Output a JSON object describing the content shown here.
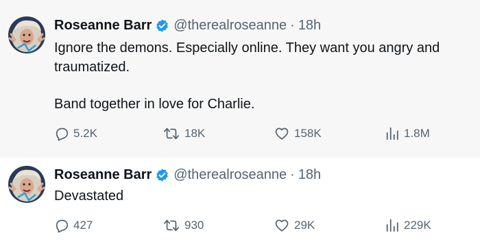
{
  "tweets": [
    {
      "author": {
        "name": "Roseanne Barr",
        "handle": "@therealroseanne",
        "verified": true,
        "avatar_icon": "avatar-photo"
      },
      "separator": "·",
      "time": "18h",
      "text_lines": [
        "Ignore the demons. Especially online. They want you angry and",
        "traumatized.",
        "Band together in love for Charlie."
      ],
      "stats": {
        "replies": "5.2K",
        "retweets": "18K",
        "likes": "158K",
        "views": "1.8M"
      }
    },
    {
      "author": {
        "name": "Roseanne Barr",
        "handle": "@therealroseanne",
        "verified": true,
        "avatar_icon": "avatar-photo"
      },
      "separator": "·",
      "time": "18h",
      "text_lines": [
        "Devastated"
      ],
      "stats": {
        "replies": "427",
        "retweets": "930",
        "likes": "29K",
        "views": "229K"
      }
    }
  ],
  "colors": {
    "text": "#0f1419",
    "muted": "#536471",
    "verified_badge": "#1d9bf0",
    "highlight_background": "#f7f7f7"
  },
  "icons": {
    "reply": "reply-icon",
    "retweet": "retweet-icon",
    "like": "like-icon",
    "views": "views-icon",
    "verified": "verified-badge-icon"
  }
}
